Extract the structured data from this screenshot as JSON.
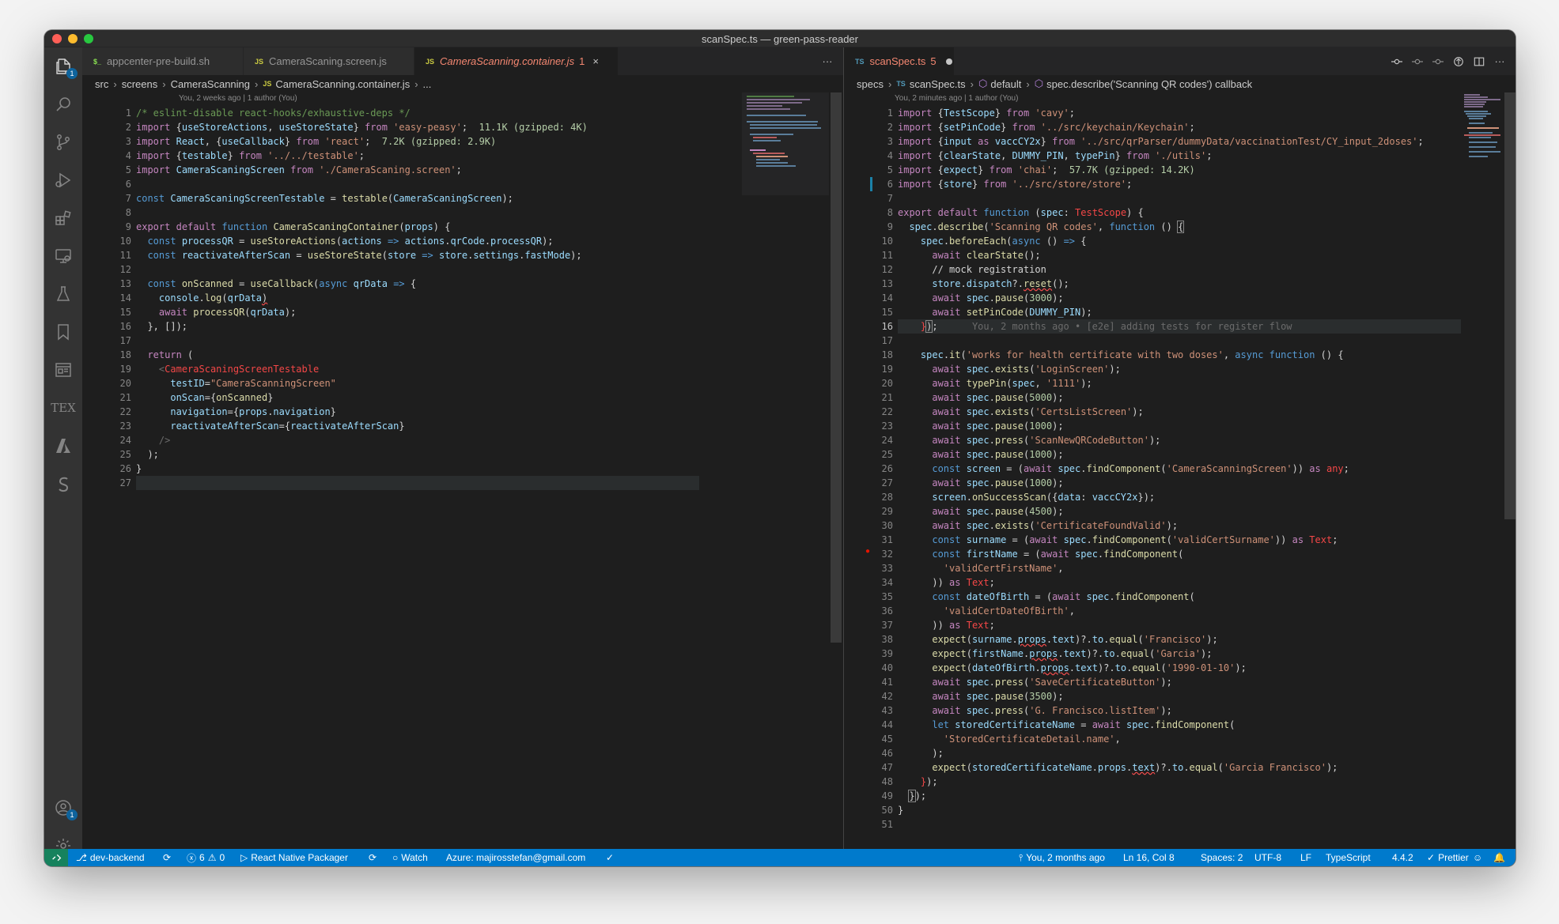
{
  "window": {
    "title": "scanSpec.ts — green-pass-reader"
  },
  "activity_bar": {
    "icons": [
      "files-icon",
      "search-icon",
      "source-control-icon",
      "run-debug-icon",
      "extensions-icon",
      "remote-explorer-icon",
      "testing-icon",
      "bookmarks-icon",
      "book-icon",
      "tex-icon",
      "azure-icon",
      "sonar-icon",
      "account-icon",
      "settings-gear-icon"
    ],
    "explorer_badge": "1",
    "account_badge": "1",
    "tex_label": "TEX"
  },
  "left_editor": {
    "tabs": [
      {
        "icon": "$_",
        "label": "appcenter-pre-build.sh"
      },
      {
        "icon": "JS",
        "label": "CameraScaning.screen.js"
      },
      {
        "icon": "JS",
        "label": "CameraScanning.container.js",
        "problems": "1",
        "close": "×"
      }
    ],
    "more_actions": "···",
    "breadcrumb": [
      "src",
      "screens",
      "CameraScanning",
      "CameraScanning.container.js",
      "..."
    ],
    "breadcrumb_file_icon": "JS",
    "blame_top": "You, 2 weeks ago | 1 author (You)",
    "line_numbers": [
      "1",
      "2",
      "3",
      "4",
      "5",
      "6",
      "7",
      "8",
      "9",
      "10",
      "11",
      "12",
      "13",
      "14",
      "15",
      "16",
      "17",
      "18",
      "19",
      "20",
      "21",
      "22",
      "23",
      "24",
      "25",
      "26",
      "27"
    ]
  },
  "right_editor": {
    "tab": {
      "icon": "TS",
      "label": "scanSpec.ts",
      "problems": "5"
    },
    "breadcrumb": [
      "specs",
      "scanSpec.ts",
      "default",
      "spec.describe('Scanning QR codes') callback"
    ],
    "breadcrumb_file_icon": "TS",
    "blame_top": "You, 2 minutes ago | 1 author (You)",
    "inline_blame": "You, 2 months ago • [e2e] adding tests for register flow",
    "line_numbers": [
      "1",
      "2",
      "3",
      "4",
      "5",
      "6",
      "7",
      "8",
      "9",
      "10",
      "11",
      "12",
      "13",
      "14",
      "15",
      "16",
      "17",
      "18",
      "19",
      "20",
      "21",
      "22",
      "23",
      "24",
      "25",
      "26",
      "27",
      "28",
      "29",
      "30",
      "31",
      "32",
      "33",
      "34",
      "35",
      "36",
      "37",
      "38",
      "39",
      "40",
      "41",
      "42",
      "43",
      "44",
      "45",
      "46",
      "47",
      "48",
      "49",
      "50",
      "51"
    ]
  },
  "status_bar": {
    "remote_icon": "remote-icon",
    "branch": "dev-backend",
    "errors": "6",
    "warnings": "0",
    "packager": "React Native Packager",
    "watch": "Watch",
    "azure": "Azure: majirosstefan@gmail.com",
    "blame": "You, 2 months ago",
    "cursor": "Ln 16, Col 8",
    "spaces": "Spaces: 2",
    "encoding": "UTF-8",
    "eol": "LF",
    "language": "TypeScript",
    "ts_version": "4.4.2",
    "formatter": "Prettier"
  },
  "colors": {
    "accent": "#007acc",
    "editor_bg": "#1e1e1e",
    "sidebar_bg": "#333333"
  }
}
